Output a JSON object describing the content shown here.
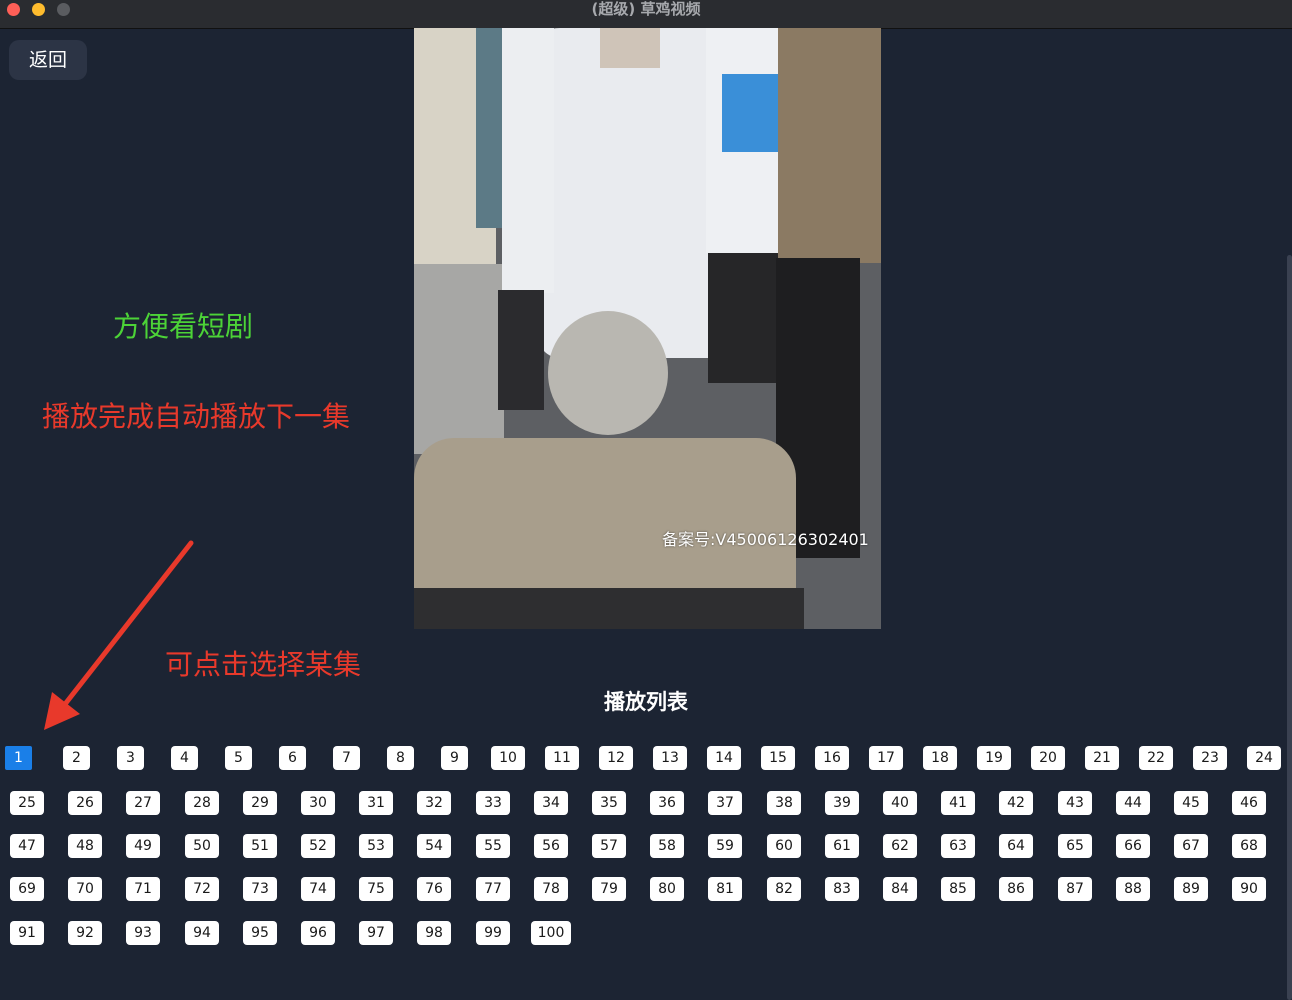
{
  "window": {
    "title": "(超级) 草鸡视频"
  },
  "nav": {
    "back_label": "返回"
  },
  "video": {
    "watermark": "备案号:V45006126302401"
  },
  "annotations": {
    "easy_watch": "方便看短剧",
    "autoplay_next": "播放完成自动播放下一集",
    "click_select": "可点击选择某集"
  },
  "playlist": {
    "title": "播放列表",
    "selected": "1",
    "episodes": [
      "1",
      "2",
      "3",
      "4",
      "5",
      "6",
      "7",
      "8",
      "9",
      "10",
      "11",
      "12",
      "13",
      "14",
      "15",
      "16",
      "17",
      "18",
      "19",
      "20",
      "21",
      "22",
      "23",
      "24",
      "25",
      "26",
      "27",
      "28",
      "29",
      "30",
      "31",
      "32",
      "33",
      "34",
      "35",
      "36",
      "37",
      "38",
      "39",
      "40",
      "41",
      "42",
      "43",
      "44",
      "45",
      "46",
      "47",
      "48",
      "49",
      "50",
      "51",
      "52",
      "53",
      "54",
      "55",
      "56",
      "57",
      "58",
      "59",
      "60",
      "61",
      "62",
      "63",
      "64",
      "65",
      "66",
      "67",
      "68",
      "69",
      "70",
      "71",
      "72",
      "73",
      "74",
      "75",
      "76",
      "77",
      "78",
      "79",
      "80",
      "81",
      "82",
      "83",
      "84",
      "85",
      "86",
      "87",
      "88",
      "89",
      "90",
      "91",
      "92",
      "93",
      "94",
      "95",
      "96",
      "97",
      "98",
      "99",
      "100"
    ]
  },
  "colors": {
    "background": "#1c2433",
    "annotation_green": "#4cd337",
    "annotation_red": "#e8392b",
    "selected_episode": "#1a7fe8"
  }
}
